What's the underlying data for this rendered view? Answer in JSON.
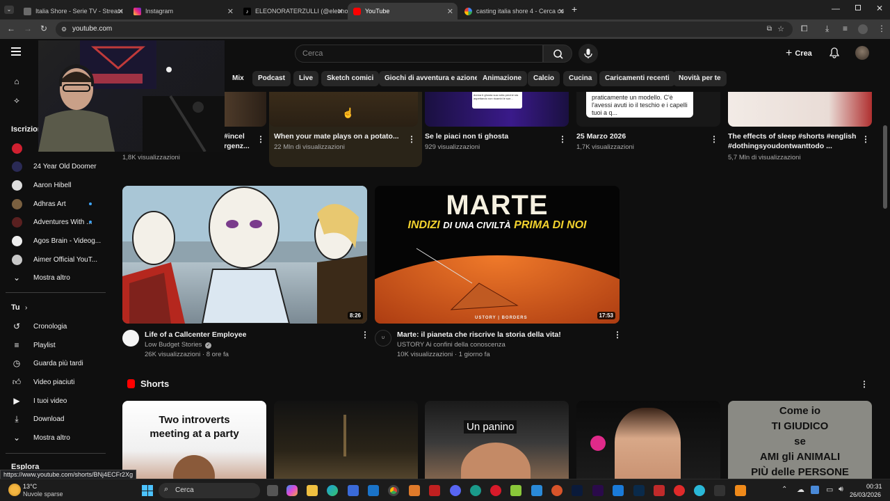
{
  "browser": {
    "tabs": [
      {
        "title": "Italia Shore - Serie TV - Stream"
      },
      {
        "title": "Instagram"
      },
      {
        "title": "ELEONORATERZULLI (@eleono"
      },
      {
        "title": "YouTube"
      },
      {
        "title": "casting italia shore 4 - Cerca co"
      }
    ],
    "url": "youtube.com",
    "status_link": "https://www.youtube.com/shorts/BNj4ECFr2Xg"
  },
  "youtube": {
    "search_placeholder": "Cerca",
    "create_label": "Crea",
    "chips": [
      "Mix",
      "Podcast",
      "Live",
      "Sketch comici",
      "Giochi di avventura e azione",
      "Animazione",
      "Calcio",
      "Cucina",
      "Caricamenti recenti",
      "Novità per te"
    ],
    "sidebar": {
      "subscriptions_header": "Iscrizioni",
      "subscriptions": [
        {
          "label": "24 Year Old Doomer"
        },
        {
          "label": "Aaron Hibell"
        },
        {
          "label": "Adhras Art"
        },
        {
          "label": "Adventures With ..."
        },
        {
          "label": "Agos Brain - Videog..."
        },
        {
          "label": "Aimer Official YouT..."
        }
      ],
      "show_more": "Mostra altro",
      "you_header": "Tu",
      "you_items": [
        {
          "label": "Cronologia",
          "icon": "history-icon"
        },
        {
          "label": "Playlist",
          "icon": "playlist-icon"
        },
        {
          "label": "Guarda più tardi",
          "icon": "watch-later-icon"
        },
        {
          "label": "Video piaciuti",
          "icon": "thumb-up-icon"
        },
        {
          "label": "I tuoi video",
          "icon": "your-videos-icon"
        },
        {
          "label": "Download",
          "icon": "download-icon"
        }
      ],
      "show_more_2": "Mostra altro",
      "explore_header": "Esplora"
    },
    "top_row": [
      {
        "title": "#incel\nrgenz...",
        "views": "1,8K visualizzazioni"
      },
      {
        "title": "When your mate plays on a potato...",
        "views": "22 Mln di visualizzazioni"
      },
      {
        "title": "Se le piaci non ti ghosta",
        "views": "929 visualizzazioni"
      },
      {
        "title": "25 Marzo 2026",
        "views": "1,7K visualizzazioni"
      },
      {
        "title": "The effects of sleep #shorts #english #dothingsyoudontwanttodo ...",
        "views": "5,7 Mln di visualizzazioni"
      }
    ],
    "top_row_thumb_text": {
      "c3": "donna ti ghosta sua volta perché sta aspettando non ricambi le sue...",
      "c4": "praticamente un modello. C'è l'avessi avuti io il teschio e i capelli tuoi a q..."
    },
    "videos": [
      {
        "title": "Life of a Callcenter Employee",
        "channel": "Low Budget Stories",
        "meta": "26K visualizzazioni · 8 ore fa",
        "duration": "8:26"
      },
      {
        "title": "Marte: il pianeta che riscrive la storia della vita!",
        "channel": "USTORY Ai confini della conoscenza",
        "meta": "10K visualizzazioni · 1 giorno fa",
        "duration": "17:53",
        "thumb_text": {
          "line1": "MARTE",
          "line2a": "INDIZI",
          "line2b": "DI UNA CIVILTÀ",
          "line2c": "PRIMA DI NOI",
          "brand": "USTORY | BORDERS"
        }
      }
    ],
    "shorts_header": "Shorts",
    "shorts": [
      {
        "overlay": "Two introverts\nmeeting at a party"
      },
      {
        "overlay": ""
      },
      {
        "overlay": "Un panino"
      },
      {
        "overlay": ""
      },
      {
        "overlay": "Come io\nTI GIUDICO\nse\nAMI gli ANIMALI\nPIÙ delle PERSONE"
      }
    ]
  },
  "taskbar": {
    "weather_temp": "13°C",
    "weather_desc": "Nuvole sparse",
    "search_label": "Cerca",
    "time": "00:31",
    "date": "26/03/2026"
  },
  "colors": {
    "bg": "#0f0f0f",
    "chip": "#272727",
    "accent_red": "#ff0000",
    "link_blue": "#3ea6ff"
  }
}
